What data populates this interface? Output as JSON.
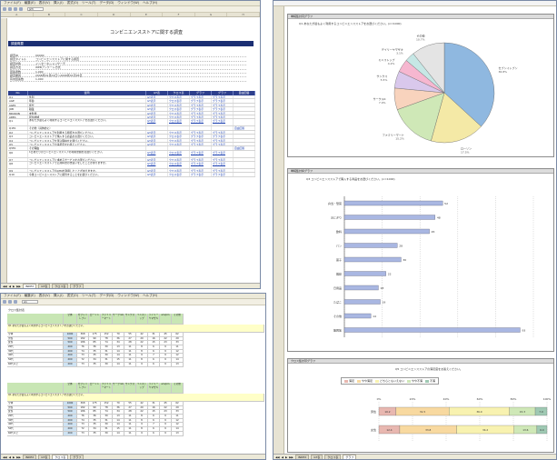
{
  "menu": [
    "ファイル(F)",
    "編集(E)",
    "表示(V)",
    "挿入(I)",
    "書式(O)",
    "ツール(T)",
    "データ(D)",
    "ウィンドウ(W)",
    "ヘルプ(H)"
  ],
  "w1": {
    "namebox": "J23",
    "title": "コンビニエンスストアに関する調査",
    "band": "調査概要",
    "meta": [
      {
        "k": "調査ID",
        "v": "00000"
      },
      {
        "k": "調査タイトル",
        "v": "コンビニエンスストアに関する調査"
      },
      {
        "k": "調査対象",
        "v": "インターネットリサーチ"
      },
      {
        "k": "調査方法",
        "v": "WEBアンケート方式"
      },
      {
        "k": "回答者数",
        "v": "1,000"
      },
      {
        "k": "調査期間",
        "v": "2006年01月01日〜2006年01月05日"
      },
      {
        "k": "有効回答数",
        "v": "1,000"
      }
    ],
    "table_headers": [
      "No",
      "質問",
      "GT表",
      "クロス表",
      "グラフ",
      "グラフ",
      "自由回答"
    ],
    "rows": [
      [
        "Q1",
        "性別",
        "GT表示",
        "クロス表示",
        "グラフ表示",
        "グラフ表示",
        ""
      ],
      [
        "AGE",
        "年齢",
        "GT表示",
        "クロス表示",
        "グラフ表示",
        "グラフ表示",
        ""
      ],
      [
        "AGE1",
        "年代",
        "GT表示",
        "クロス表示",
        "グラフ表示",
        "グラフ表示",
        ""
      ],
      [
        "JOB",
        "職業",
        "GT表示",
        "クロス表示",
        "グラフ表示",
        "グラフ表示",
        ""
      ],
      [
        "MIKIKON",
        "未既婚",
        "GT表示",
        "クロス表示",
        "グラフ表示",
        "グラフ表示",
        ""
      ],
      [
        "AREA",
        "居住地域",
        "GT表示",
        "クロス表示",
        "グラフ表示",
        "グラフ表示",
        ""
      ],
      [
        "Q1",
        "あなたが最もよく利用するコンビニエンスストアをお選びください。",
        "GT表示",
        "クロス表示",
        "グラフ表示",
        "グラフ表示",
        ""
      ],
      [
        "Q1FA",
        "その他（具体的に）",
        "",
        "",
        "",
        "",
        "自由回答"
      ],
      [
        "Q2",
        "コンビニエンスストアを利用する頻度をお選びください。",
        "GT表示",
        "クロス表示",
        "グラフ表示",
        "グラフ表示",
        ""
      ],
      [
        "Q3",
        "コンビニエンスストアで購入する商品をお選びください。",
        "GT表示",
        "クロス表示",
        "グラフ表示",
        "グラフ表示",
        ""
      ],
      [
        "Q4",
        "コンビニエンスストアを選ぶ理由をお選びください。",
        "GT表示",
        "クロス表示",
        "グラフ表示",
        "グラフ表示",
        ""
      ],
      [
        "Q5",
        "コンビニエンスストアの満足度をお答えください。",
        "GT表示",
        "クロス表示",
        "グラフ表示",
        "グラフ表示",
        ""
      ],
      [
        "Q5FA",
        "その理由",
        "",
        "",
        "",
        "",
        "自由回答"
      ],
      [
        "Q6",
        "1日あたりのコンビニエンスストアの利用金額をお選びください。",
        "GT表示",
        "クロス表示",
        "グラフ表示",
        "グラフ表示",
        ""
      ],
      [
        "Q7",
        "コンビニエンスストアに求めるサービスをお選びください。",
        "GT表示",
        "クロス表示",
        "グラフ表示",
        "グラフ表示",
        ""
      ],
      [
        "Q8",
        "コンビニエンスストアで公共料金の支払いをしたことがありますか。",
        "GT表示",
        "クロス表示",
        "グラフ表示",
        "グラフ表示",
        ""
      ],
      [
        "Q9",
        "コンビニエンスストアのATMを利用したことがありますか。",
        "GT表示",
        "クロス表示",
        "グラフ表示",
        "グラフ表示",
        ""
      ],
      [
        "Q10",
        "今後コンビニエンスストアに期待することをお選びください。",
        "GT表示",
        "クロス表示",
        "グラフ表示",
        "グラフ表示",
        ""
      ]
    ],
    "tabs": [
      "INDEX",
      "GT表",
      "クロス表",
      "グラフ"
    ]
  },
  "w2": {
    "namebox": "A1",
    "section": "クロス集計表",
    "header": [
      "",
      "全体",
      "セブンイレブン",
      "ローソン",
      "ファミリーマート",
      "サークルK",
      "サンクス",
      "ミニストップ",
      "デイリーヤマザキ",
      "am/pm",
      "その他"
    ],
    "question": "Q1 あなたが最もよく利用するコンビニエンスストアをお選びください。",
    "rows": [
      [
        "全体",
        "1000",
        "368",
        "175",
        "152",
        "70",
        "55",
        "42",
        "31",
        "45",
        "62"
      ],
      [
        "男性",
        "500",
        "182",
        "90",
        "78",
        "36",
        "27",
        "20",
        "16",
        "22",
        "29"
      ],
      [
        "女性",
        "500",
        "186",
        "85",
        "74",
        "34",
        "28",
        "22",
        "15",
        "23",
        "33"
      ],
      [
        "20代",
        "200",
        "76",
        "36",
        "30",
        "13",
        "11",
        "8",
        "6",
        "9",
        "11"
      ],
      [
        "30代",
        "200",
        "74",
        "35",
        "31",
        "14",
        "11",
        "8",
        "6",
        "9",
        "12"
      ],
      [
        "40代",
        "200",
        "73",
        "35",
        "30",
        "14",
        "11",
        "9",
        "7",
        "9",
        "12"
      ],
      [
        "50代",
        "200",
        "72",
        "34",
        "31",
        "15",
        "11",
        "8",
        "6",
        "9",
        "14"
      ],
      [
        "60代以上",
        "200",
        "73",
        "35",
        "30",
        "14",
        "11",
        "9",
        "6",
        "9",
        "13"
      ]
    ],
    "tabs": [
      "INDEX",
      "GT表",
      "クロス表",
      "グラフ"
    ]
  },
  "w3": {
    "panel1_bar": "単純集計円グラフ",
    "panel1_q": "Q1 あなたが最もよく利用するコンビニエンスストアをお選びください。(n=1000)",
    "panel2_bar": "単純集計棒グラフ",
    "panel2_q": "Q3 コンビニエンスストアで購入する商品をお選びください。(n=1000)",
    "panel3_bar": "クロス集計帯グラフ",
    "panel3_q": "Q5 コンビニエンスストアの満足度をお答えください。",
    "tabs": [
      "INDEX",
      "GT表",
      "クロス表",
      "グラフ"
    ]
  },
  "chart_data": [
    {
      "type": "pie",
      "title": "Q1 あなたが最もよく利用するコンビニエンスストアをお選びください。(n=1000)",
      "categories": [
        "セブンイレブン",
        "ローソン",
        "ファミリーマート",
        "サークルK",
        "サンクス",
        "ミニストップ",
        "デイリーヤマザキ",
        "その他"
      ],
      "values": [
        36.8,
        17.5,
        15.2,
        7.0,
        5.5,
        4.2,
        3.1,
        10.7
      ],
      "colors": [
        "#8fb8e0",
        "#f4e9a6",
        "#cfe8b7",
        "#f8d3bd",
        "#d9c8ec",
        "#f6b7d0",
        "#c6e7e5",
        "#e4e4e4"
      ]
    },
    {
      "type": "bar",
      "orientation": "horizontal",
      "title": "Q3 コンビニエンスストアで購入する商品をお選びください。(n=1000)",
      "categories": [
        "弁当・惣菜",
        "おにぎり",
        "飲料",
        "パン",
        "菓子",
        "雑誌",
        "日用品",
        "たばこ",
        "その他",
        "無回答"
      ],
      "values": [
        52,
        48,
        45,
        28,
        30,
        22,
        18,
        19,
        14,
        93
      ],
      "xlim": [
        0,
        100
      ],
      "color": "#a9b7e2"
    },
    {
      "type": "bar",
      "stacked": true,
      "orientation": "horizontal",
      "title": "Q5 コンビニエンスストアの満足度をお答えください。",
      "categories": [
        "男性",
        "女性"
      ],
      "series": [
        {
          "name": "満足",
          "values": [
            10.2,
            12.4
          ]
        },
        {
          "name": "やや満足",
          "values": [
            31.5,
            33.8
          ]
        },
        {
          "name": "どちらともいえない",
          "values": [
            36.0,
            34.2
          ]
        },
        {
          "name": "やや不満",
          "values": [
            15.3,
            13.6
          ]
        },
        {
          "name": "不満",
          "values": [
            7.0,
            6.0
          ]
        }
      ],
      "colors": [
        "#e8b7b0",
        "#f8d9a0",
        "#f8f2b0",
        "#cfe8b7",
        "#9fc9b3"
      ],
      "xlim": [
        0,
        100
      ]
    }
  ]
}
